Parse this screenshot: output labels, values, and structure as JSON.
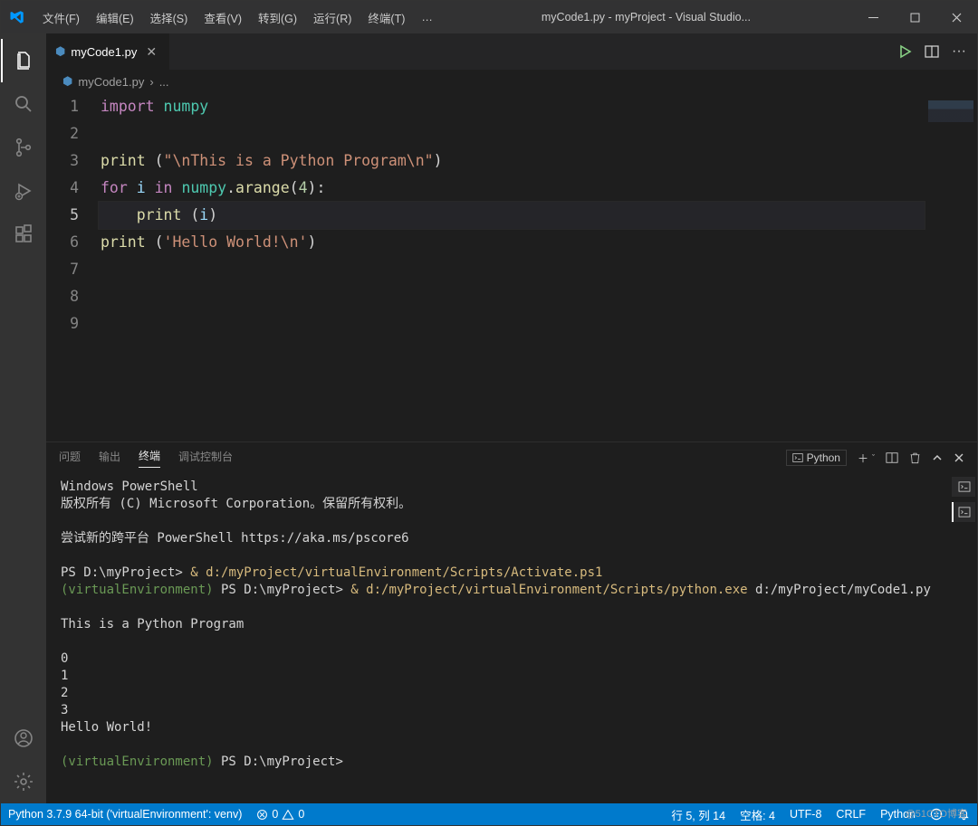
{
  "window": {
    "title": "myCode1.py - myProject - Visual Studio..."
  },
  "menu": {
    "file": "文件(F)",
    "edit": "编辑(E)",
    "select": "选择(S)",
    "view": "查看(V)",
    "goto": "转到(G)",
    "run": "运行(R)",
    "terminal": "终端(T)",
    "more": "…"
  },
  "tab": {
    "filename": "myCode1.py"
  },
  "breadcrumb": {
    "file": "myCode1.py",
    "sep": "›",
    "rest": "..."
  },
  "code_lines": [
    {
      "n": "1",
      "html": "<span class='kw'>import</span> <span class='mod'>numpy</span>"
    },
    {
      "n": "2",
      "html": ""
    },
    {
      "n": "3",
      "html": "<span class='fn'>print</span> <span class='pun'>(</span><span class='str'>\"\\nThis is a Python Program\\n\"</span><span class='pun'>)</span>"
    },
    {
      "n": "4",
      "html": "<span class='kw'>for</span> <span class='var'>i</span> <span class='kw'>in</span> <span class='mod'>numpy</span><span class='pun'>.</span><span class='fn'>arange</span><span class='pun'>(</span><span class='num'>4</span><span class='pun'>):</span>"
    },
    {
      "n": "5",
      "html": "    <span class='fn'>print</span> <span class='pun'>(</span><span class='var'>i</span><span class='pun'>)</span>",
      "current": true
    },
    {
      "n": "6",
      "html": "<span class='fn'>print</span> <span class='pun'>(</span><span class='str'>'Hello World!\\n'</span><span class='pun'>)</span>"
    },
    {
      "n": "7",
      "html": ""
    },
    {
      "n": "8",
      "html": ""
    },
    {
      "n": "9",
      "html": ""
    }
  ],
  "panel": {
    "tabs": {
      "problems": "问题",
      "output": "输出",
      "terminal": "终端",
      "debug": "调试控制台"
    },
    "interpreter": "Python"
  },
  "terminal": {
    "l1": "Windows PowerShell",
    "l2": "版权所有 (C) Microsoft Corporation。保留所有权利。",
    "l3": "尝试新的跨平台 PowerShell https://aka.ms/pscore6",
    "ps1_prefix": "PS D:\\myProject> ",
    "ps1_cmd": "& d:/myProject/virtualEnvironment/Scripts/Activate.ps1",
    "env": "(virtualEnvironment)",
    "ps2_prefix": " PS D:\\myProject> ",
    "ps2_cmd": "& d:/myProject/virtualEnvironment/Scripts/python.exe",
    "ps2_tail": " d:/myProject/myCode1.py",
    "out1": "This is a Python Program",
    "o0": "0",
    "o1": "1",
    "o2": "2",
    "o3": "3",
    "out2": "Hello World!",
    "ps3_prefix": " PS D:\\myProject>"
  },
  "status": {
    "interpreter": "Python 3.7.9 64-bit ('virtualEnvironment': venv)",
    "errors": "0",
    "warnings": "0",
    "lncol": "行 5,  列 14",
    "spaces": "空格: 4",
    "encoding": "UTF-8",
    "eol": "CRLF",
    "lang": "Python"
  },
  "watermark": "@51CTO博客"
}
